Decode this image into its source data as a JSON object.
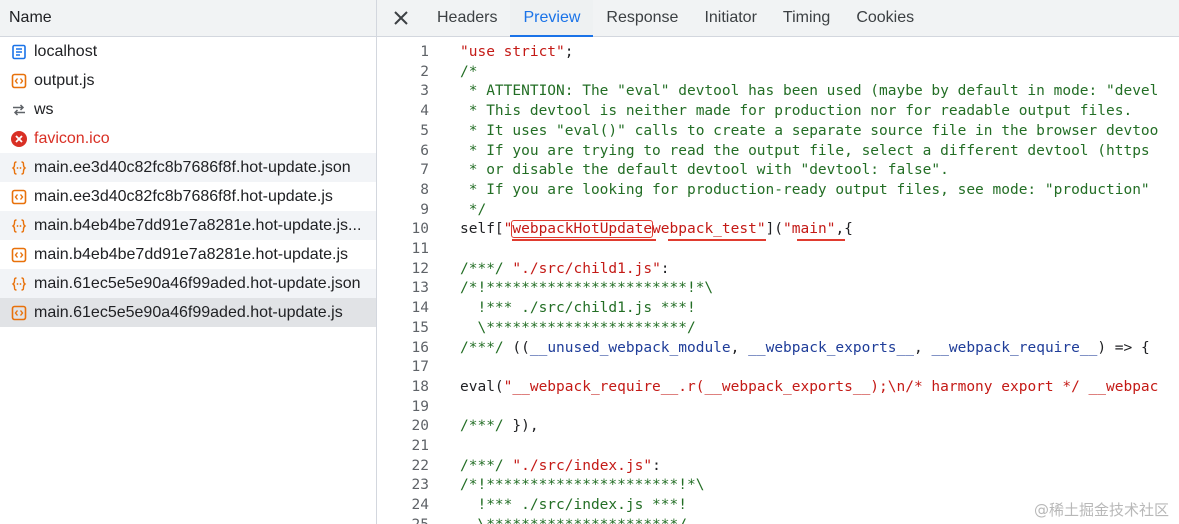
{
  "request_list": {
    "header": "Name",
    "rows": [
      {
        "label": "localhost",
        "icon": "document-icon",
        "icon_color": "#1a73e8",
        "striped": false,
        "selected": false,
        "error": false
      },
      {
        "label": "output.js",
        "icon": "script-icon",
        "icon_color": "#e8710a",
        "striped": false,
        "selected": false,
        "error": false
      },
      {
        "label": "ws",
        "icon": "websocket-icon",
        "icon_color": "#5f6368",
        "striped": false,
        "selected": false,
        "error": false
      },
      {
        "label": "favicon.ico",
        "icon": "error-icon",
        "icon_color": "#d93025",
        "striped": false,
        "selected": false,
        "error": true
      },
      {
        "label": "main.ee3d40c82fc8b7686f8f.hot-update.json",
        "icon": "json-icon",
        "icon_color": "#e8710a",
        "striped": true,
        "selected": false,
        "error": false
      },
      {
        "label": "main.ee3d40c82fc8b7686f8f.hot-update.js",
        "icon": "script-icon",
        "icon_color": "#e8710a",
        "striped": false,
        "selected": false,
        "error": false
      },
      {
        "label": "main.b4eb4be7dd91e7a8281e.hot-update.js...",
        "icon": "json-icon",
        "icon_color": "#e8710a",
        "striped": true,
        "selected": false,
        "error": false
      },
      {
        "label": "main.b4eb4be7dd91e7a8281e.hot-update.js",
        "icon": "script-icon",
        "icon_color": "#e8710a",
        "striped": false,
        "selected": false,
        "error": false
      },
      {
        "label": "main.61ec5e5e90a46f99aded.hot-update.json",
        "icon": "json-icon",
        "icon_color": "#e8710a",
        "striped": true,
        "selected": false,
        "error": false
      },
      {
        "label": "main.61ec5e5e90a46f99aded.hot-update.js",
        "icon": "script-icon",
        "icon_color": "#e8710a",
        "striped": false,
        "selected": true,
        "error": false
      }
    ]
  },
  "tabs": {
    "close": "×",
    "items": [
      {
        "label": "Headers",
        "active": false
      },
      {
        "label": "Preview",
        "active": true
      },
      {
        "label": "Response",
        "active": false
      },
      {
        "label": "Initiator",
        "active": false
      },
      {
        "label": "Timing",
        "active": false
      },
      {
        "label": "Cookies",
        "active": false
      }
    ]
  },
  "code_lines": [
    {
      "n": "1",
      "t": "\"use strict\";"
    },
    {
      "n": "2",
      "t": "/*"
    },
    {
      "n": "3",
      "t": " * ATTENTION: The \"eval\" devtool has been used (maybe by default in mode: \"devel"
    },
    {
      "n": "4",
      "t": " * This devtool is neither made for production nor for readable output files."
    },
    {
      "n": "5",
      "t": " * It uses \"eval()\" calls to create a separate source file in the browser devtoo"
    },
    {
      "n": "6",
      "t": " * If you are trying to read the output file, select a different devtool (https"
    },
    {
      "n": "7",
      "t": " * or disable the default devtool with \"devtool: false\"."
    },
    {
      "n": "8",
      "t": " * If you are looking for production-ready output files, see mode: \"production\""
    },
    {
      "n": "9",
      "t": " */"
    },
    {
      "n": "10",
      "t": "self[\"webpackHotUpdatewebpack_test\"](\"main\",{"
    },
    {
      "n": "11",
      "t": ""
    },
    {
      "n": "12",
      "t": "/***/ \"./src/child1.js\":"
    },
    {
      "n": "13",
      "t": "/*!***********************!*\\"
    },
    {
      "n": "14",
      "t": "  !*** ./src/child1.js ***!"
    },
    {
      "n": "15",
      "t": "  \\***********************/"
    },
    {
      "n": "16",
      "t": "/***/ ((__unused_webpack_module, __webpack_exports__, __webpack_require__) => {"
    },
    {
      "n": "17",
      "t": ""
    },
    {
      "n": "18",
      "t": "eval(\"__webpack_require__.r(__webpack_exports__);\\n/* harmony export */ __webpac"
    },
    {
      "n": "19",
      "t": ""
    },
    {
      "n": "20",
      "t": "/***/ }),"
    },
    {
      "n": "21",
      "t": ""
    },
    {
      "n": "22",
      "t": "/***/ \"./src/index.js\":"
    },
    {
      "n": "23",
      "t": "/*!**********************!*\\"
    },
    {
      "n": "24",
      "t": "  !*** ./src/index.js ***!"
    },
    {
      "n": "25",
      "t": "  \\**********************/"
    }
  ],
  "line10_parts": {
    "pre": "self[\"",
    "boxed": "webpackHotUpdate",
    "mid": "webpack_test",
    "post1": "\"](\"",
    "main": "main",
    "post2": "\",{"
  },
  "watermark": "@稀土掘金技术社区"
}
